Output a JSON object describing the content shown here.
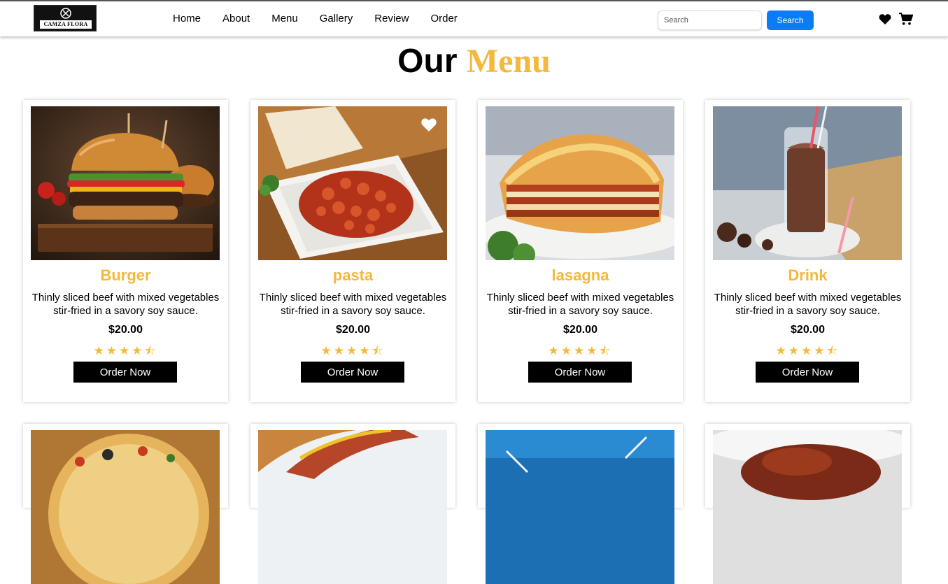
{
  "header": {
    "logo_text": "CAMZA FLORA",
    "nav": [
      "Home",
      "About",
      "Menu",
      "Gallery",
      "Review",
      "Order"
    ],
    "search": {
      "placeholder": "Search",
      "button_label": "Search"
    },
    "icons": [
      "heart-icon",
      "cart-icon"
    ]
  },
  "section": {
    "title_part1": "Our",
    "title_part2": "Menu"
  },
  "accent_color": "#f4b83c",
  "search_button_color": "#0b7cf6",
  "items": [
    {
      "name": "Burger",
      "description": "Thinly sliced beef with mixed vegetables stir-fried in a savory soy sauce.",
      "price": "$20.00",
      "rating": 4.5,
      "stars": "★★★★⯪",
      "button": "Order Now"
    },
    {
      "name": "pasta",
      "description": "Thinly sliced beef with mixed vegetables stir-fried in a savory soy sauce.",
      "price": "$20.00",
      "rating": 4.5,
      "stars": "★★★★⯪",
      "button": "Order Now",
      "favorite_icon": "heart-icon"
    },
    {
      "name": "lasagna",
      "description": "Thinly sliced beef with mixed vegetables stir-fried in a savory soy sauce.",
      "price": "$20.00",
      "rating": 4.5,
      "stars": "★★★★⯪",
      "button": "Order Now"
    },
    {
      "name": "Drink",
      "description": "Thinly sliced beef with mixed vegetables stir-fried in a savory soy sauce.",
      "price": "$20.00",
      "rating": 4.5,
      "stars": "★★★★⯪",
      "button": "Order Now"
    }
  ]
}
